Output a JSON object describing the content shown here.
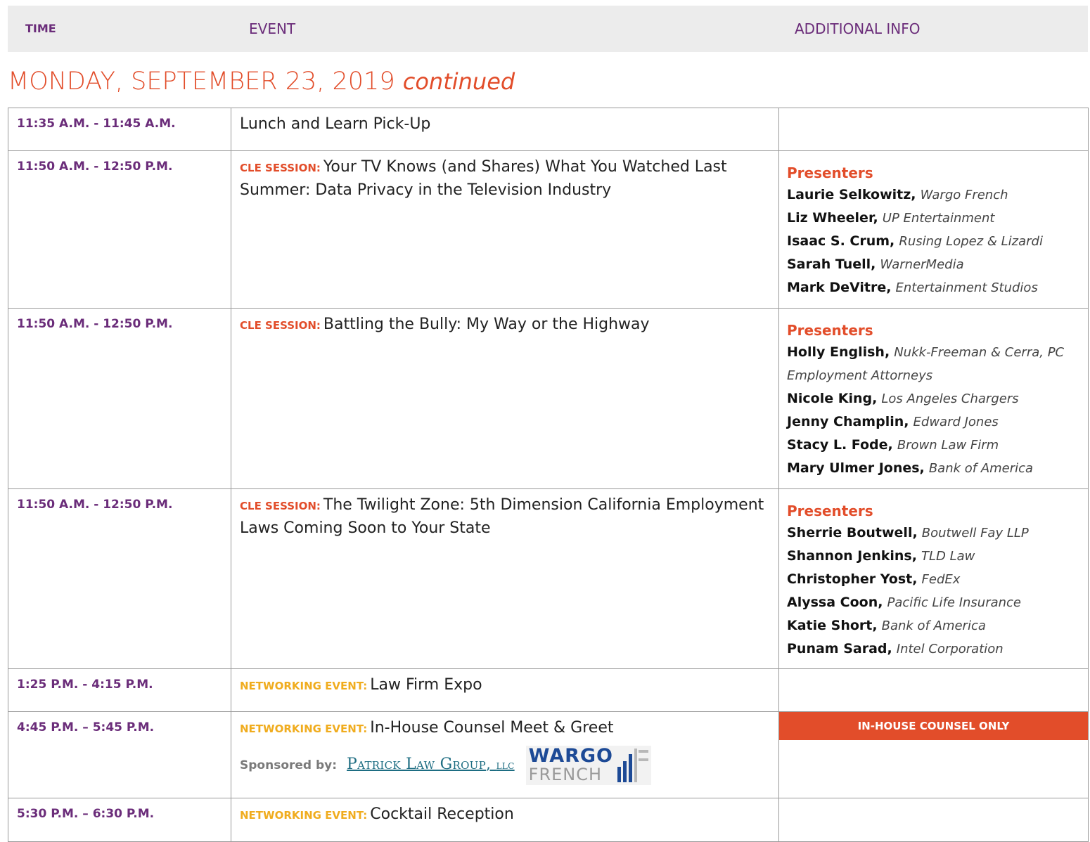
{
  "header": {
    "time": "TIME",
    "event": "EVENT",
    "info": "ADDITIONAL INFO"
  },
  "day": {
    "title": "MONDAY, SEPTEMBER 23, 2019",
    "continued": "continued"
  },
  "colors": {
    "accent_orange": "#e24d2a",
    "purple": "#6b2d7a",
    "networking_yellow": "#f0ac1e",
    "header_bg": "#ececec"
  },
  "rows": [
    {
      "time": "11:35 A.M. - 11:45 A.M.",
      "tag": "",
      "event": "Lunch and Learn Pick-Up"
    },
    {
      "time": "11:50 A.M. - 12:50 P.M.",
      "tag": "CLE SESSION:",
      "event": "Your TV Knows (and Shares) What You Watched Last Summer: Data Privacy in the Television Industry",
      "presenters_heading": "Presenters",
      "presenters": [
        {
          "name": "Laurie Selkowitz,",
          "org": "Wargo French"
        },
        {
          "name": "Liz Wheeler,",
          "org": "UP Entertainment"
        },
        {
          "name": "Isaac S. Crum,",
          "org": "Rusing Lopez & Lizardi"
        },
        {
          "name": "Sarah Tuell,",
          "org": "WarnerMedia"
        },
        {
          "name": "Mark DeVitre,",
          "org": "Entertainment Studios"
        }
      ]
    },
    {
      "time": "11:50 A.M. - 12:50 P.M.",
      "tag": "CLE SESSION:",
      "event": "Battling the Bully: My Way or the Highway",
      "presenters_heading": "Presenters",
      "presenters": [
        {
          "name": "Holly English,",
          "org": "Nukk-Freeman & Cerra, PC Employment Attorneys"
        },
        {
          "name": "Nicole King,",
          "org": "Los Angeles Chargers"
        },
        {
          "name": "Jenny Champlin,",
          "org": "Edward Jones"
        },
        {
          "name": "Stacy L. Fode,",
          "org": "Brown Law Firm"
        },
        {
          "name": "Mary Ulmer Jones,",
          "org": "Bank of America"
        }
      ]
    },
    {
      "time": "11:50 A.M. - 12:50 P.M.",
      "tag": "CLE SESSION:",
      "event": "The Twilight Zone: 5th Dimension California Employment Laws Coming Soon to Your State",
      "presenters_heading": "Presenters",
      "presenters": [
        {
          "name": "Sherrie Boutwell,",
          "org": "Boutwell Fay LLP"
        },
        {
          "name": "Shannon Jenkins,",
          "org": "TLD Law"
        },
        {
          "name": "Christopher Yost,",
          "org": "FedEx"
        },
        {
          "name": "Alyssa Coon,",
          "org": "Pacific Life Insurance"
        },
        {
          "name": "Katie Short,",
          "org": "Bank of America"
        },
        {
          "name": "Punam Sarad,",
          "org": "Intel Corporation"
        }
      ]
    },
    {
      "time": "1:25 P.M. - 4:15 P.M.",
      "tag": "NETWORKING EVENT:",
      "event": "Law Firm Expo"
    },
    {
      "time": "4:45 P.M. – 5:45 P.M.",
      "tag": "NETWORKING EVENT:",
      "event": "In-House Counsel Meet & Greet",
      "badge": "IN-HOUSE COUNSEL ONLY",
      "sponsor_label": "Sponsored by:",
      "sponsor_logo_1": "Patrick Law Group",
      "sponsor_logo_1_suffix": "LLC",
      "sponsor_logo_2_top": "WARGO",
      "sponsor_logo_2_bottom": "FRENCH"
    },
    {
      "time": "5:30 P.M. – 6:30 P.M.",
      "tag": "NETWORKING EVENT:",
      "event": "Cocktail Reception"
    }
  ]
}
